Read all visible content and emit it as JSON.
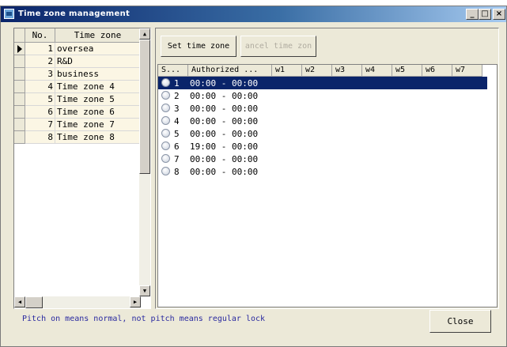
{
  "window": {
    "title": "Time zone management",
    "icons": {
      "app": "app-window-icon",
      "min": "minimize-icon",
      "max": "maximize-icon",
      "close": "close-icon"
    },
    "min_glyph": "_",
    "max_glyph": "□",
    "close_glyph": "×"
  },
  "left_table": {
    "headers": {
      "no": "No.",
      "name": "Time zone"
    },
    "selected_row": 0,
    "rows": [
      {
        "no": "1",
        "name": "oversea"
      },
      {
        "no": "2",
        "name": "R&D"
      },
      {
        "no": "3",
        "name": "business"
      },
      {
        "no": "4",
        "name": "Time zone 4"
      },
      {
        "no": "5",
        "name": "Time zone 5"
      },
      {
        "no": "6",
        "name": "Time zone 6"
      },
      {
        "no": "7",
        "name": "Time zone 7"
      },
      {
        "no": "8",
        "name": "Time zone 8"
      }
    ],
    "scroll": {
      "up": "▲",
      "down": "▼",
      "left": "◀",
      "right": "▶"
    }
  },
  "toolbar": {
    "set_label": "Set time zone",
    "cancel_label": "ancel time zon"
  },
  "right_table": {
    "headers": {
      "status": "S...",
      "authorized": "Authorized ...",
      "w1": "w1",
      "w2": "w2",
      "w3": "w3",
      "w4": "w4",
      "w5": "w5",
      "w6": "w6",
      "w7": "w7"
    },
    "selected_row": 0,
    "rows": [
      {
        "id": "1",
        "time": "00:00 - 00:00"
      },
      {
        "id": "2",
        "time": "00:00 - 00:00"
      },
      {
        "id": "3",
        "time": "00:00 - 00:00"
      },
      {
        "id": "4",
        "time": "00:00 - 00:00"
      },
      {
        "id": "5",
        "time": "00:00 - 00:00"
      },
      {
        "id": "6",
        "time": "19:00 - 00:00"
      },
      {
        "id": "7",
        "time": "00:00 - 00:00"
      },
      {
        "id": "8",
        "time": "00:00 - 00:00"
      }
    ]
  },
  "footer": {
    "hint": "Pitch on means normal, not pitch means regular lock",
    "close_label": "Close"
  }
}
